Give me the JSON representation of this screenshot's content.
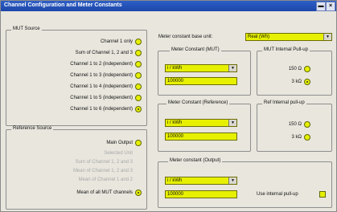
{
  "window": {
    "title": "Channel Configuration and Meter Constants",
    "min_label": "▬",
    "close_label": "×"
  },
  "mut_source": {
    "title": "MUT Source",
    "items": [
      {
        "label": "Channel 1 only",
        "checked": false
      },
      {
        "label": "Sum of Channel 1, 2 and 3",
        "checked": false
      },
      {
        "label": "Channel 1 to 2 (independent)",
        "checked": false
      },
      {
        "label": "Channel 1 to 3 (independent)",
        "checked": false
      },
      {
        "label": "Channel 1 to 4 (independent)",
        "checked": false
      },
      {
        "label": "Channel 1 to 5 (independent)",
        "checked": false
      },
      {
        "label": "Channel 1 to 6 (independent)",
        "checked": true
      }
    ]
  },
  "reference_source": {
    "title": "Reference Source",
    "items": [
      {
        "label": "Main Output",
        "checked": false,
        "enabled": true
      },
      {
        "label": "Selected Unit",
        "checked": false,
        "enabled": false
      },
      {
        "label": "Sum of Channel 1, 2 and 3",
        "checked": false,
        "enabled": false
      },
      {
        "label": "Mean of Channel 1, 2 and 3",
        "checked": false,
        "enabled": false
      },
      {
        "label": "Mean of Channel 1 and 2",
        "checked": false,
        "enabled": false
      },
      {
        "label": "Mean of all MUT channels",
        "checked": true,
        "enabled": true
      }
    ]
  },
  "base_unit": {
    "label": "Meter constant base unit:",
    "value": "Real (Wh)"
  },
  "meter_constant_mut": {
    "title": "Meter Constant (MUT)",
    "unit": "i / kWh",
    "value": "100000"
  },
  "meter_constant_reference": {
    "title": "Meter Constant (Reference)",
    "unit": "i / kWh",
    "value": "100000"
  },
  "meter_constant_output": {
    "title": "Meter constant (Output)",
    "unit": "i / kWh",
    "value": "100000",
    "pullup_label": "Use internal pull-up"
  },
  "mut_pullup": {
    "title": "MUT Internal Pull-up",
    "options": [
      {
        "label": "150 Ω",
        "checked": false
      },
      {
        "label": "3 kΩ",
        "checked": true
      }
    ]
  },
  "ref_pullup": {
    "title": "Ref Internal pull-up",
    "options": [
      {
        "label": "150 Ω",
        "checked": false
      },
      {
        "label": "3 kΩ",
        "checked": false
      }
    ]
  },
  "colors": {
    "field_yellow": "#e6f000",
    "title_blue": "#1d46a8",
    "window_bg": "#e8e6dd"
  }
}
